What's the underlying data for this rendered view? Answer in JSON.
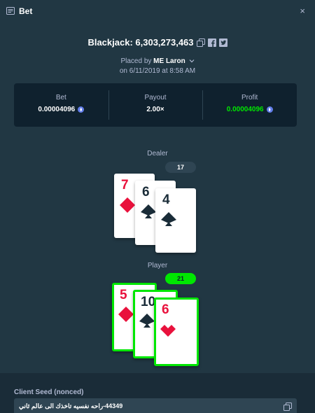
{
  "header": {
    "title": "Bet",
    "close": "×"
  },
  "game": {
    "title": "Blackjack: 6,303,273,463",
    "placed_prefix": "Placed by ",
    "user": "ME Laron",
    "date": "on 6/11/2019 at 8:58 AM"
  },
  "stats": {
    "bet_label": "Bet",
    "bet_value": "0.00004096",
    "payout_label": "Payout",
    "payout_value": "2.00×",
    "profit_label": "Profit",
    "profit_value": "0.00004096",
    "currency_icon": "ethereum-icon"
  },
  "dealer": {
    "label": "Dealer",
    "total": "17",
    "cards": [
      {
        "rank": "7",
        "suit": "diamond",
        "color": "red"
      },
      {
        "rank": "6",
        "suit": "spade",
        "color": "black"
      },
      {
        "rank": "4",
        "suit": "spade",
        "color": "black"
      }
    ]
  },
  "player": {
    "label": "Player",
    "total": "21",
    "cards": [
      {
        "rank": "5",
        "suit": "diamond",
        "color": "red"
      },
      {
        "rank": "10",
        "suit": "club",
        "color": "black"
      },
      {
        "rank": "6",
        "suit": "heart",
        "color": "red"
      }
    ]
  },
  "seed": {
    "label": "Client Seed (nonced)",
    "value": "44349-راحه نفسيه تاخذك الى عالم ثاني"
  },
  "colors": {
    "win": "#00e701",
    "panel": "#0f212e",
    "background": "#213743"
  }
}
